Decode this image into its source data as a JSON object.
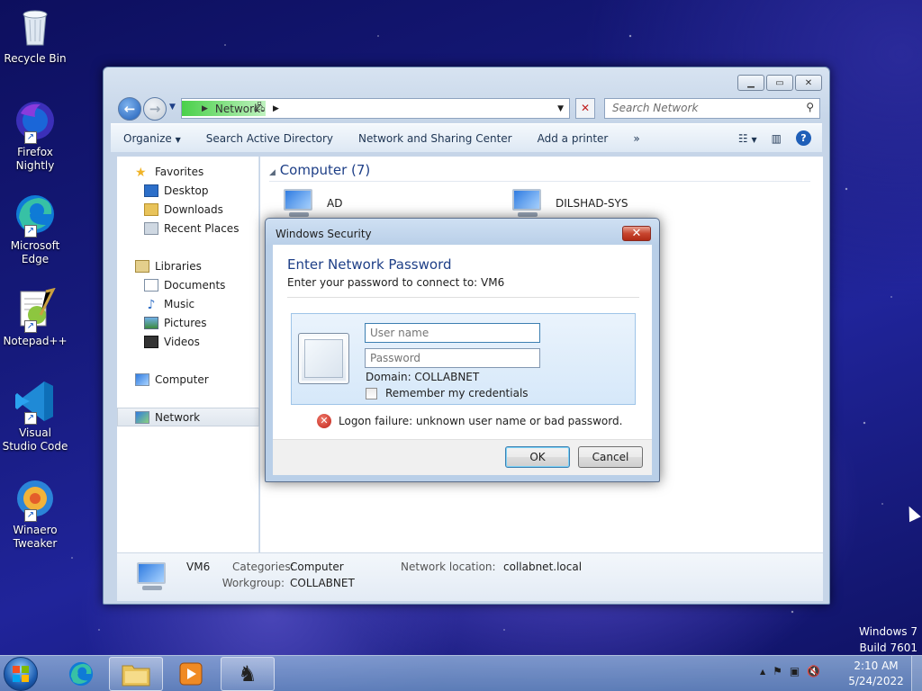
{
  "desktop": {
    "icons": [
      {
        "label": "Recycle Bin",
        "icon": "recycle-bin-icon"
      },
      {
        "label": "Firefox Nightly",
        "icon": "firefox-nightly-icon"
      },
      {
        "label": "Microsoft Edge",
        "icon": "edge-icon"
      },
      {
        "label": "Notepad++",
        "icon": "notepad-plus-plus-icon"
      },
      {
        "label": "Visual Studio Code",
        "icon": "vscode-icon"
      },
      {
        "label": "Winaero Tweaker",
        "icon": "winaero-tweaker-icon"
      }
    ],
    "watermark": {
      "line1": "Windows 7",
      "line2": "Build 7601"
    }
  },
  "window": {
    "address": {
      "location": "Network"
    },
    "search": {
      "placeholder": "Search Network"
    },
    "toolbar": {
      "organize": "Organize",
      "items": [
        "Search Active Directory",
        "Network and Sharing Center",
        "Add a printer"
      ],
      "more": "»"
    },
    "nav": {
      "favorites": "Favorites",
      "favorites_items": [
        "Desktop",
        "Downloads",
        "Recent Places"
      ],
      "libraries": "Libraries",
      "libraries_items": [
        "Documents",
        "Music",
        "Pictures",
        "Videos"
      ],
      "computer": "Computer",
      "network": "Network"
    },
    "content": {
      "group_header": "Computer (7)",
      "computers": [
        "AD",
        "DILSHAD-SYS"
      ]
    },
    "status_bar": {
      "name": "VM6",
      "categories_label": "Categories:",
      "categories_value": "Computer",
      "workgroup_label": "Workgroup:",
      "workgroup_value": "COLLABNET",
      "location_label": "Network location:",
      "location_value": "collabnet.local"
    }
  },
  "dialog": {
    "title": "Windows Security",
    "heading": "Enter Network Password",
    "subtitle": "Enter your password to connect to: VM6",
    "username_placeholder": "User name",
    "password_placeholder": "Password",
    "domain": "Domain: COLLABNET",
    "remember": "Remember my credentials",
    "error": "Logon failure: unknown user name or bad password.",
    "ok": "OK",
    "cancel": "Cancel"
  },
  "taskbar": {
    "time": "2:10 AM",
    "date": "5/24/2022"
  },
  "colors": {
    "accent": "#1e3f87",
    "error": "#c0221a",
    "address_highlight": "#4ad04a"
  }
}
